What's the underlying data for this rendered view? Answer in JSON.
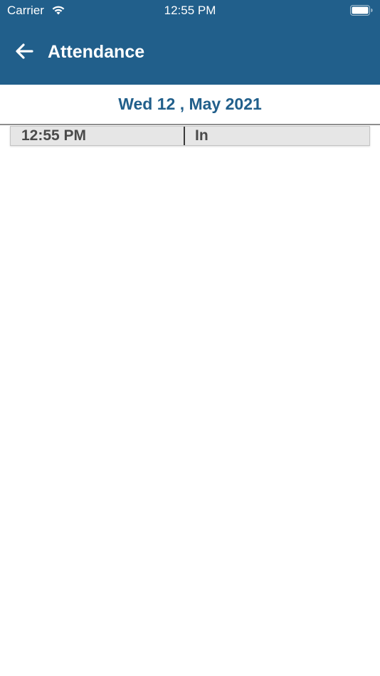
{
  "status_bar": {
    "carrier": "Carrier",
    "time": "12:55 PM",
    "wifi_icon": "wifi-icon",
    "battery_icon": "battery-icon"
  },
  "nav": {
    "title": "Attendance",
    "back_icon": "back-arrow-icon"
  },
  "date_heading": "Wed 12 , May 2021",
  "records": [
    {
      "time": "12:55 PM",
      "type": "In"
    }
  ],
  "colors": {
    "header_bg": "#215f8b",
    "date_text": "#215f8b",
    "row_bg": "#e6e6e6"
  }
}
